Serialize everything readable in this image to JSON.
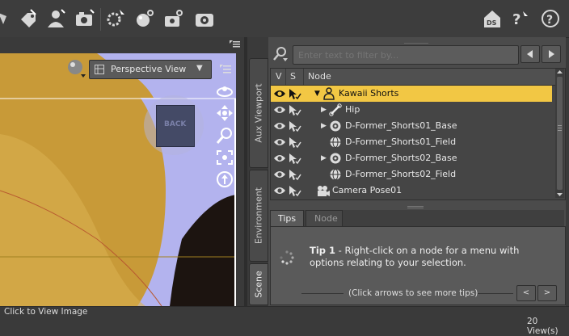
{
  "viewport": {
    "view_select": "Perspective View",
    "cube_label": "BACK"
  },
  "side_tabs": {
    "aux_viewport": "Aux Viewport",
    "environment": "Environment",
    "scene": "Scene"
  },
  "scene": {
    "filter_placeholder": "Enter text to filter by...",
    "columns": [
      "V",
      "S",
      "Node"
    ],
    "nodes": [
      {
        "label": "Kawaii Shorts",
        "selected": true,
        "expander": "down",
        "icon": "figure-icon"
      },
      {
        "label": "Hip",
        "selected": false,
        "expander": "right",
        "icon": "bone-icon"
      },
      {
        "label": "D-Former_Shorts01_Base",
        "selected": false,
        "expander": "right",
        "icon": "dformer-base-icon"
      },
      {
        "label": "D-Former_Shorts01_Field",
        "selected": false,
        "expander": "",
        "icon": "dformer-field-icon"
      },
      {
        "label": "D-Former_Shorts02_Base",
        "selected": false,
        "expander": "right",
        "icon": "dformer-base-icon"
      },
      {
        "label": "D-Former_Shorts02_Field",
        "selected": false,
        "expander": "",
        "icon": "dformer-field-icon"
      },
      {
        "label": "Camera Pose01",
        "selected": false,
        "expander": "",
        "icon": "camera-icon"
      }
    ],
    "bottom_tabs": [
      "Tips",
      "Node"
    ],
    "tip_title": "Tip 1",
    "tip_text": " - Right-click on a node for a menu with options relating to your selection.",
    "tip_nav": "(Click arrows to see more tips)",
    "prev_label": "<",
    "next_label": ">"
  },
  "status": {
    "left": "Click to View Image",
    "right": "20 View(s)"
  },
  "colors": {
    "selection": "#f2c744",
    "viewport_bg": "#b3b3ee",
    "figure": "#c89a38"
  }
}
